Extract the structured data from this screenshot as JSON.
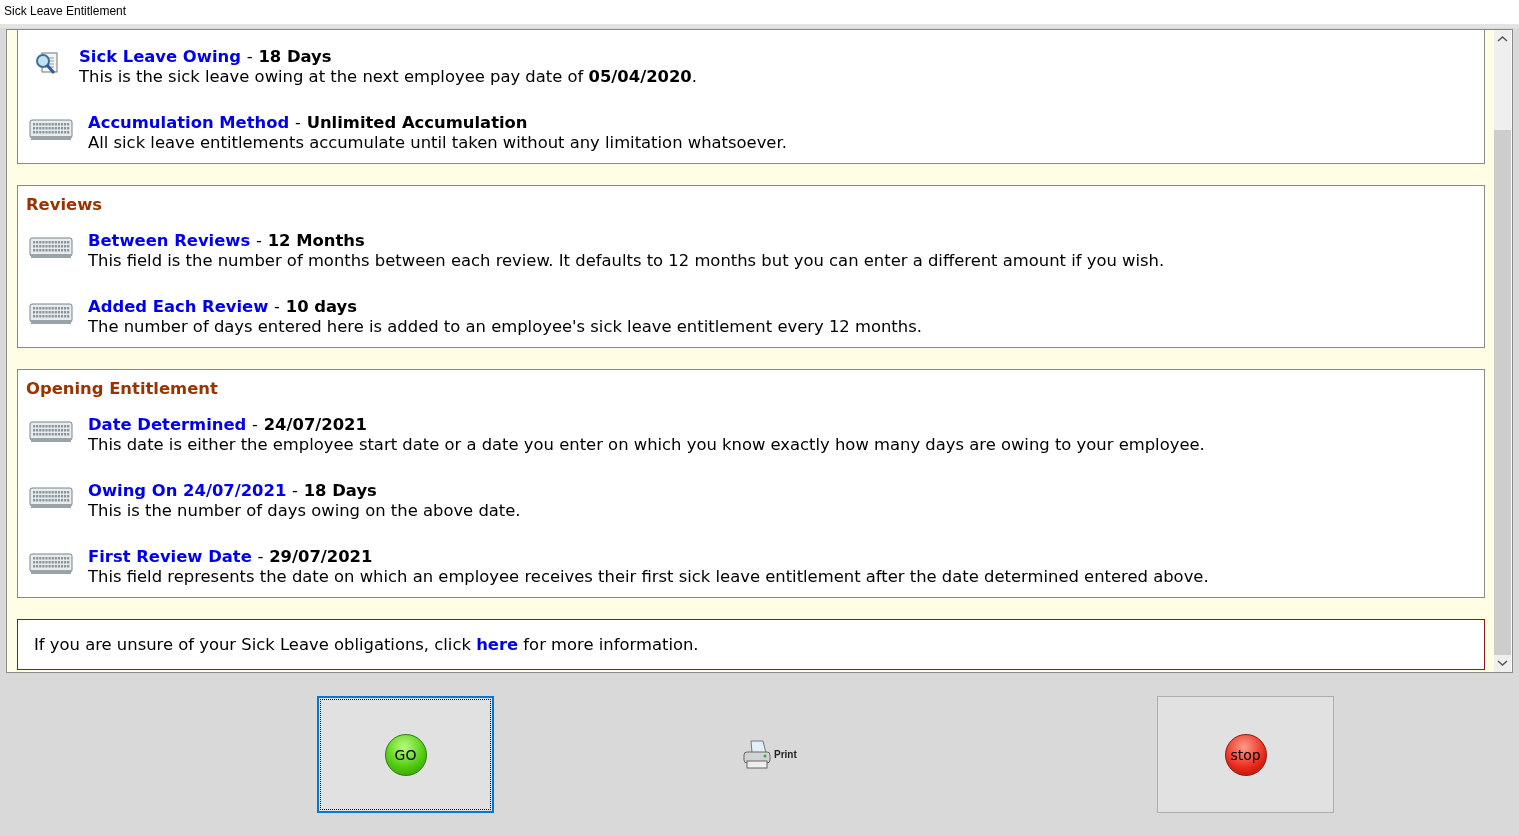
{
  "window": {
    "title": "Sick Leave Entitlement"
  },
  "sections": [
    {
      "items": [
        {
          "kind": "search",
          "label": "Sick Leave Owing",
          "separator": "-",
          "value": "18 Days",
          "description": "This is the sick leave owing at the next employee pay date of **05/04/2020**."
        },
        {
          "kind": "keyboard",
          "label": "Accumulation Method",
          "separator": "-",
          "value": "Unlimited Accumulation",
          "description": "All sick leave entitlements accumulate until taken without any limitation whatsoever."
        }
      ]
    },
    {
      "heading": "Reviews",
      "items": [
        {
          "kind": "keyboard",
          "label": "Between Reviews",
          "separator": "-",
          "value": "12 Months",
          "description": "This field is the number of months between each review. It defaults to 12 months but you can enter a different amount if you wish."
        },
        {
          "kind": "keyboard",
          "label": "Added Each Review",
          "separator": "-",
          "value": "10 days",
          "description": "The number of days entered here is added to an employee's sick leave entitlement every 12 months."
        }
      ]
    },
    {
      "heading": "Opening Entitlement",
      "items": [
        {
          "kind": "keyboard",
          "label": "Date Determined",
          "separator": "-",
          "value": "24/07/2021",
          "description": "This date is either the employee start date or a date you enter on which you know exactly how many days are owing to your employee."
        },
        {
          "kind": "keyboard",
          "label": "Owing On 24/07/2021",
          "separator": "-",
          "value": "18 Days",
          "description": "This is the number of days owing on the above date."
        },
        {
          "kind": "keyboard",
          "label": "First Review Date",
          "separator": "-",
          "value": "29/07/2021",
          "description": "This field represents the date on which an employee receives their first sick leave entitlement after the date determined entered above."
        }
      ]
    }
  ],
  "info": {
    "before": "If you are unsure of your Sick Leave obligations, click ",
    "link": "here",
    "after": " for more information."
  },
  "buttons": [
    {
      "kind": "go",
      "label": "GO",
      "focused": true
    },
    {
      "kind": "print",
      "label": "Print",
      "focused": false
    },
    {
      "kind": "stop",
      "label": "stop",
      "focused": false
    }
  ]
}
